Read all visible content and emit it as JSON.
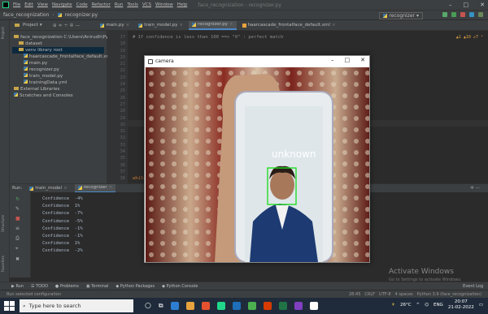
{
  "menu": {
    "items": [
      "File",
      "Edit",
      "View",
      "Navigate",
      "Code",
      "Refactor",
      "Run",
      "Tools",
      "VCS",
      "Window",
      "Help"
    ],
    "title": "face_recognization - recognizer.py",
    "window_controls": [
      "–",
      "□",
      "✕"
    ]
  },
  "navbar": {
    "project": "face_recognization",
    "file": "recognizer.py",
    "run_config": "recognizer"
  },
  "tabs": [
    {
      "label": "main.py",
      "active": false
    },
    {
      "label": "train_model.py",
      "active": false
    },
    {
      "label": "recognizer.py",
      "active": true
    },
    {
      "label": "haarcascade_frontalface_default.xml",
      "active": false
    }
  ],
  "project_panel": {
    "header": "Project",
    "items": [
      {
        "label": "face_recognization  C:\\Users\\Anirudh\\Py",
        "level": 0,
        "folder": true,
        "selected": false
      },
      {
        "label": "dataset",
        "level": 1,
        "folder": true,
        "selected": false
      },
      {
        "label": "venv  library root",
        "level": 1,
        "folder": true,
        "selected": true
      },
      {
        "label": "haarcascade_frontalface_default.xml",
        "level": 2,
        "folder": false,
        "selected": false
      },
      {
        "label": "main.py",
        "level": 2,
        "folder": false,
        "selected": false
      },
      {
        "label": "recognizer.py",
        "level": 2,
        "folder": false,
        "selected": false
      },
      {
        "label": "train_model.py",
        "level": 2,
        "folder": false,
        "selected": false
      },
      {
        "label": "trainingData.yml",
        "level": 2,
        "folder": false,
        "selected": false
      },
      {
        "label": "External Libraries",
        "level": 0,
        "folder": true,
        "selected": false
      },
      {
        "label": "Scratches and Consoles",
        "level": 0,
        "folder": false,
        "selected": false
      }
    ]
  },
  "editor": {
    "line_numbers": [
      "17",
      "18",
      "19",
      "20",
      "21",
      "22",
      "23",
      "24",
      "25",
      "26",
      "27",
      "28",
      "29",
      "30",
      "31",
      "32",
      "33",
      "34",
      "35",
      "36",
      "37",
      "38"
    ],
    "code_line": "# If confidence is less than 100 ==> \"0\" : perfect match",
    "last_line": "while"
  },
  "run_panel": {
    "label": "Run:",
    "tabs": [
      "train_model",
      "recognizer"
    ],
    "console": [
      "Confidence  -4%",
      "Confidence  1%",
      "Confidence  -7%",
      "Confidence  -5%",
      "Confidence  -1%",
      "Confidence  -1%",
      "Confidence  1%",
      "Confidence  -2%"
    ]
  },
  "camera_window": {
    "title": "camera",
    "label": "unknown",
    "controls": [
      "–",
      "□",
      "✕"
    ]
  },
  "watermark": {
    "line1": "Activate Windows",
    "line2": "Go to Settings to activate Windows."
  },
  "bottom_tabs": [
    "Run",
    "TODO",
    "Problems",
    "Terminal",
    "Python Packages",
    "Python Console"
  ],
  "event_log": "Event Log",
  "status": {
    "left": "Run selected configuration",
    "right": [
      "28:45",
      "CRLF",
      "UTF-8",
      "4 spaces",
      "Python 3.9 (face_recognization)"
    ]
  },
  "taskbar": {
    "search_placeholder": "Type here to search",
    "weather": "26°C",
    "lang": "ENG",
    "time": "20:07",
    "date": "21-02-2022"
  },
  "colors": {
    "accent": "#4a88c7",
    "face_box": "#22dd22",
    "taskbar": "#1f2b3a"
  }
}
